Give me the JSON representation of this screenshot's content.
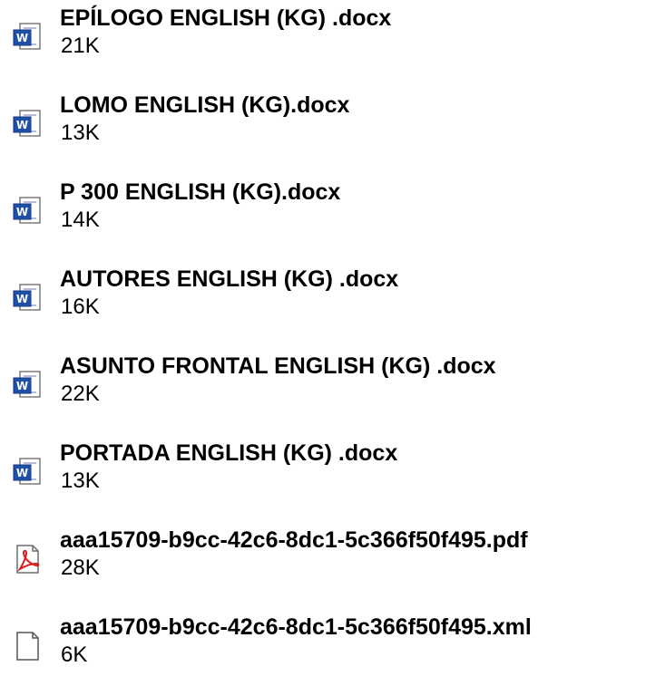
{
  "files": [
    {
      "name": "EPÍLOGO ENGLISH (KG) .docx",
      "size": "21K",
      "icon": "word-document-icon"
    },
    {
      "name": "LOMO ENGLISH (KG).docx",
      "size": "13K",
      "icon": "word-document-icon"
    },
    {
      "name": "P 300 ENGLISH (KG).docx",
      "size": "14K",
      "icon": "word-document-icon"
    },
    {
      "name": "AUTORES ENGLISH (KG) .docx",
      "size": "16K",
      "icon": "word-document-icon"
    },
    {
      "name": "ASUNTO FRONTAL ENGLISH (KG) .docx",
      "size": "22K",
      "icon": "word-document-icon"
    },
    {
      "name": "PORTADA ENGLISH (KG) .docx",
      "size": "13K",
      "icon": "word-document-icon"
    },
    {
      "name": "aaa15709-b9cc-42c6-8dc1-5c366f50f495.pdf",
      "size": "28K",
      "icon": "pdf-document-icon"
    },
    {
      "name": "aaa15709-b9cc-42c6-8dc1-5c366f50f495.xml",
      "size": "6K",
      "icon": "generic-file-icon"
    }
  ],
  "colors": {
    "word_blue": "#1f4fa8",
    "pdf_red": "#d81e1e",
    "icon_outline": "#555555"
  }
}
